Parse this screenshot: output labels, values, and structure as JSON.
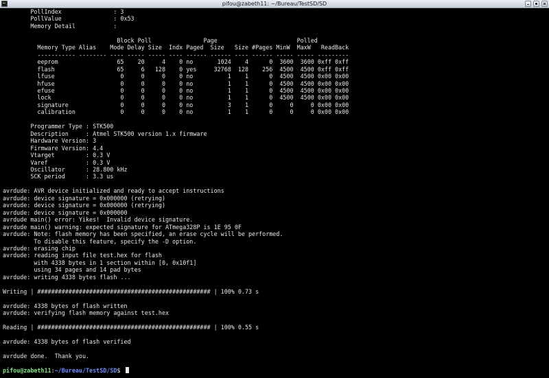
{
  "window": {
    "title": "pifou@zabeth11: ~/Bureau/TestSD/SD"
  },
  "terminal": {
    "lines": [
      "        PollIndex               : 3",
      "        PollValue               : 0x53",
      "        Memory Detail           :",
      "",
      "                                 Block Poll               Page                       Polled",
      "          Memory Type Alias    Mode Delay Size  Indx Paged  Size   Size #Pages MinW  MaxW   ReadBack",
      "          ----------- -------- ---- ----- ----- ---- ------ ------ ---- ------ ----- ----- ---------",
      "          eeprom                 65    20     4    0 no       1024    4      0  3600  3600 0xff 0xff",
      "          flash                  65     6   128    0 yes     32768  128    256  4500  4500 0xff 0xff",
      "          lfuse                   0     0     0    0 no          1    1      0  4500  4500 0x00 0x00",
      "          hfuse                   0     0     0    0 no          1    1      0  4500  4500 0x00 0x00",
      "          efuse                   0     0     0    0 no          1    1      0  4500  4500 0x00 0x00",
      "          lock                    0     0     0    0 no          1    1      0  4500  4500 0x00 0x00",
      "          signature               0     0     0    0 no          3    1      0     0     0 0x00 0x00",
      "          calibration             0     0     0    0 no          1    1      0     0     0 0x00 0x00",
      "",
      "        Programmer Type : STK500",
      "        Description     : Atmel STK500 version 1.x firmware",
      "        Hardware Version: 3",
      "        Firmware Version: 4.4",
      "        Vtarget         : 0.3 V",
      "        Varef           : 0.3 V",
      "        Oscillator      : 28.800 kHz",
      "        SCK period      : 3.3 us",
      "",
      "avrdude: AVR device initialized and ready to accept instructions",
      "avrdude: device signature = 0x000000 (retrying)",
      "avrdude: device signature = 0x000000 (retrying)",
      "avrdude: device signature = 0x000000",
      "avrdude main() error: Yikes!  Invalid device signature.",
      "avrdude main() warning: expected signature for ATmega328P is 1E 95 0F",
      "avrdude: Note: flash memory has been specified, an erase cycle will be performed.",
      "         To disable this feature, specify the -D option.",
      "avrdude: erasing chip",
      "avrdude: reading input file test.hex for flash",
      "         with 4338 bytes in 1 section within [0, 0x10f1]",
      "         using 34 pages and 14 pad bytes",
      "avrdude: writing 4338 bytes flash ...",
      "",
      "Writing | ################################################## | 100% 0.73 s",
      "",
      "avrdude: 4338 bytes of flash written",
      "avrdude: verifying flash memory against test.hex",
      "",
      "Reading | ################################################## | 100% 0.55 s",
      "",
      "avrdude: 4338 bytes of flash verified",
      "",
      "avrdude done.  Thank you.",
      ""
    ],
    "prompt": {
      "user_host": "pifou@zabeth11",
      "separator": ":",
      "path": "~/Bureau/TestSD/SD",
      "symbol": "$ "
    }
  },
  "colors": {
    "background": "#000000",
    "text": "#e8e8e8",
    "prompt_user": "#7ce57c",
    "prompt_path": "#6b8cff"
  }
}
